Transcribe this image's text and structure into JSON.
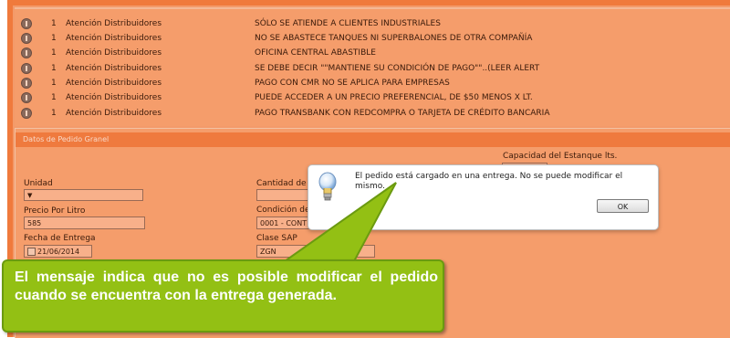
{
  "alerts": [
    {
      "count": "1",
      "source": "Atención Distribuidores",
      "message": "SÓLO SE ATIENDE A CLIENTES INDUSTRIALES"
    },
    {
      "count": "1",
      "source": "Atención Distribuidores",
      "message": "NO SE ABASTECE TANQUES NI SUPERBALONES DE OTRA COMPAÑÍA"
    },
    {
      "count": "1",
      "source": "Atención Distribuidores",
      "message": "OFICINA CENTRAL ABASTIBLE"
    },
    {
      "count": "1",
      "source": "Atención Distribuidores",
      "message": "SE DEBE DECIR \"\"MANTIENE SU CONDICIÓN DE PAGO\"\"..(LEER ALERT"
    },
    {
      "count": "1",
      "source": "Atención Distribuidores",
      "message": "PAGO CON CMR NO SE APLICA PARA EMPRESAS"
    },
    {
      "count": "1",
      "source": "Atención Distribuidores",
      "message": "PUEDE ACCEDER A UN PRECIO PREFERENCIAL, DE $50 MENOS X LT."
    },
    {
      "count": "1",
      "source": "Atención Distribuidores",
      "message": "PAGO TRANSBANK CON REDCOMPRA O TARJETA DE CRÉDITO BANCARIA"
    }
  ],
  "order_panel": {
    "title": "Datos de Pedido Granel",
    "capacidad_label": "Capacidad del Estanque lts.",
    "unidad_label": "Unidad",
    "unidad_value": "",
    "cantidad_label": "Cantidad de L",
    "precio_label": "Precio Por Litro",
    "precio_value": "585",
    "condicion_label": "Condición de",
    "condicion_value": "0001 - CONT",
    "fecha_label": "Fecha de Entrega",
    "fecha_value": "21/06/2014",
    "clase_label": "Clase SAP",
    "clase_value": "ZGN"
  },
  "dialog": {
    "message": "El pedido está cargado en una entrega. No se puede modificar el mismo.",
    "ok_label": "OK"
  },
  "callout": {
    "text": "El mensaje indica que no es posible modificar el pedido cuando se encuentra  con la entrega generada."
  },
  "colors": {
    "frame": "#f07a3c",
    "panel": "#f59d6b",
    "callout": "#93c014"
  }
}
